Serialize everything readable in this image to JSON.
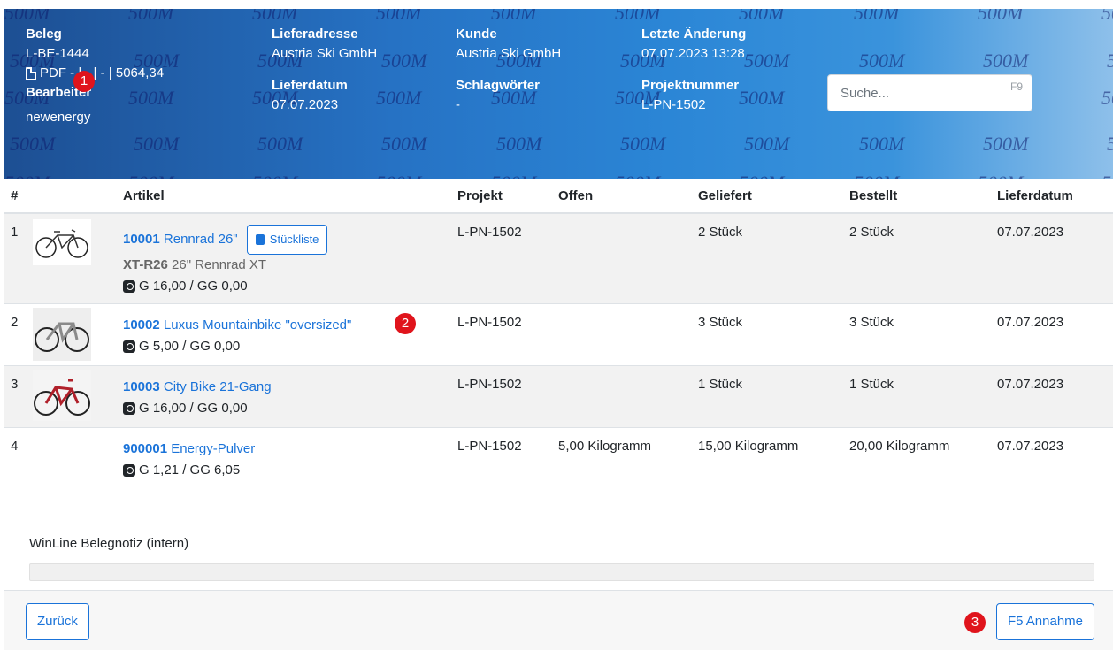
{
  "watermark_text": "500M",
  "header": {
    "beleg_label": "Beleg",
    "beleg_value": "L-BE-1444",
    "pdf_line": "PDF - | - | - | 5064,34",
    "bearbeiter_label": "Bearbeiter",
    "bearbeiter_value": "newenergy",
    "lieferadresse_label": "Lieferadresse",
    "lieferadresse_value": "Austria Ski GmbH",
    "lieferdatum_label": "Lieferdatum",
    "lieferdatum_value": "07.07.2023",
    "kunde_label": "Kunde",
    "kunde_value": "Austria Ski GmbH",
    "schlagwoerter_label": "Schlagwörter",
    "schlagwoerter_value": "-",
    "letzte_aenderung_label": "Letzte Änderung",
    "letzte_aenderung_value": "07.07.2023 13:28",
    "projektnummer_label": "Projektnummer",
    "projektnummer_value": "L-PN-1502"
  },
  "search": {
    "placeholder": "Suche...",
    "shortcut": "F9"
  },
  "badges": {
    "b1": "1",
    "b2": "2",
    "b3": "3"
  },
  "table": {
    "headers": {
      "num": "#",
      "artikel": "Artikel",
      "projekt": "Projekt",
      "offen": "Offen",
      "geliefert": "Geliefert",
      "bestellt": "Bestellt",
      "lieferdatum": "Lieferdatum"
    },
    "rows": [
      {
        "num": "1",
        "code": "10001",
        "name": "Rennrad 26\"",
        "stueckliste": "Stückliste",
        "sub_code": "XT-R26",
        "sub_text": "26\" Rennrad XT",
        "weight": "G 16,00 / GG 0,00",
        "projekt": "L-PN-1502",
        "offen": "",
        "geliefert": "2 Stück",
        "bestellt": "2 Stück",
        "lieferdatum": "07.07.2023"
      },
      {
        "num": "2",
        "code": "10002",
        "name": "Luxus Mountainbike \"oversized\"",
        "weight": "G 5,00 / GG 0,00",
        "projekt": "L-PN-1502",
        "offen": "",
        "geliefert": "3 Stück",
        "bestellt": "3 Stück",
        "lieferdatum": "07.07.2023"
      },
      {
        "num": "3",
        "code": "10003",
        "name": "City Bike 21-Gang",
        "weight": "G 16,00 / GG 0,00",
        "projekt": "L-PN-1502",
        "offen": "",
        "geliefert": "1 Stück",
        "bestellt": "1 Stück",
        "lieferdatum": "07.07.2023"
      },
      {
        "num": "4",
        "code": "900001",
        "name": "Energy-Pulver",
        "weight": "G 1,21 / GG 6,05",
        "projekt": "L-PN-1502",
        "offen": "5,00 Kilogramm",
        "geliefert": "15,00 Kilogramm",
        "bestellt": "20,00 Kilogramm",
        "lieferdatum": "07.07.2023"
      }
    ]
  },
  "notiz": {
    "label": "WinLine Belegnotiz (intern)",
    "value": ""
  },
  "footer": {
    "back_label": "Zurück",
    "accept_label": "F5 Annahme"
  },
  "colors": {
    "accent": "#1a73d9",
    "badge": "#e0141c",
    "banner_start": "#1d4f93",
    "banner_end": "#8ec0ea"
  }
}
